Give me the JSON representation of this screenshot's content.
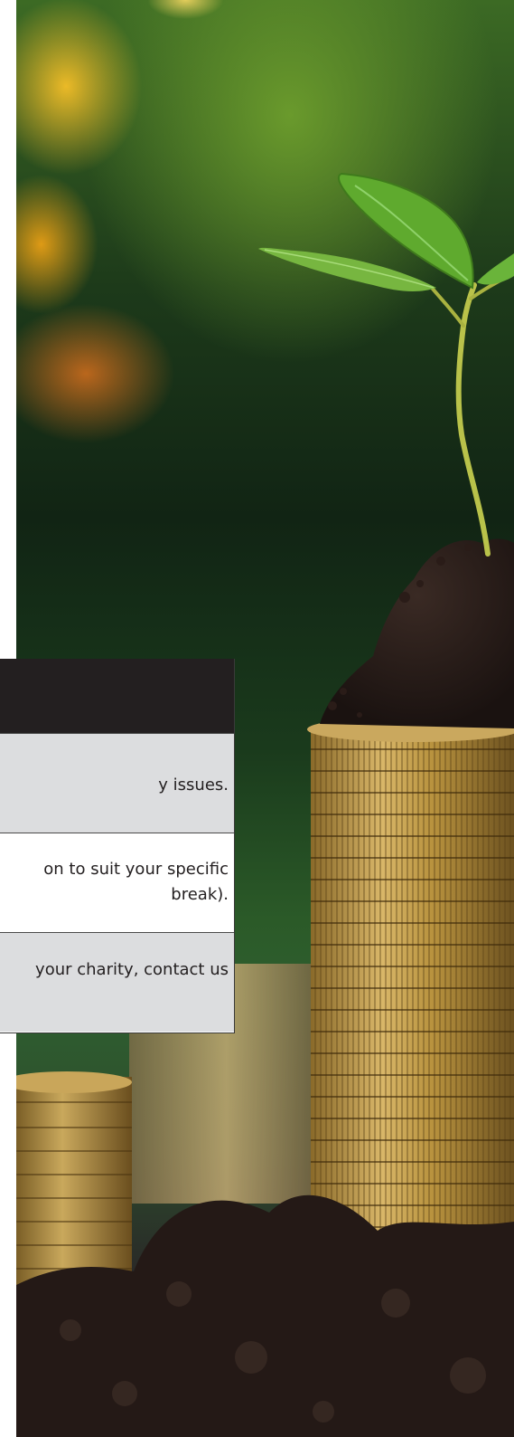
{
  "table": {
    "rows": [
      {
        "lines": [
          "y issues."
        ]
      },
      {
        "lines": [
          "on to suit your specific",
          "break)."
        ]
      },
      {
        "lines": [
          "your charity, contact us"
        ]
      }
    ]
  }
}
